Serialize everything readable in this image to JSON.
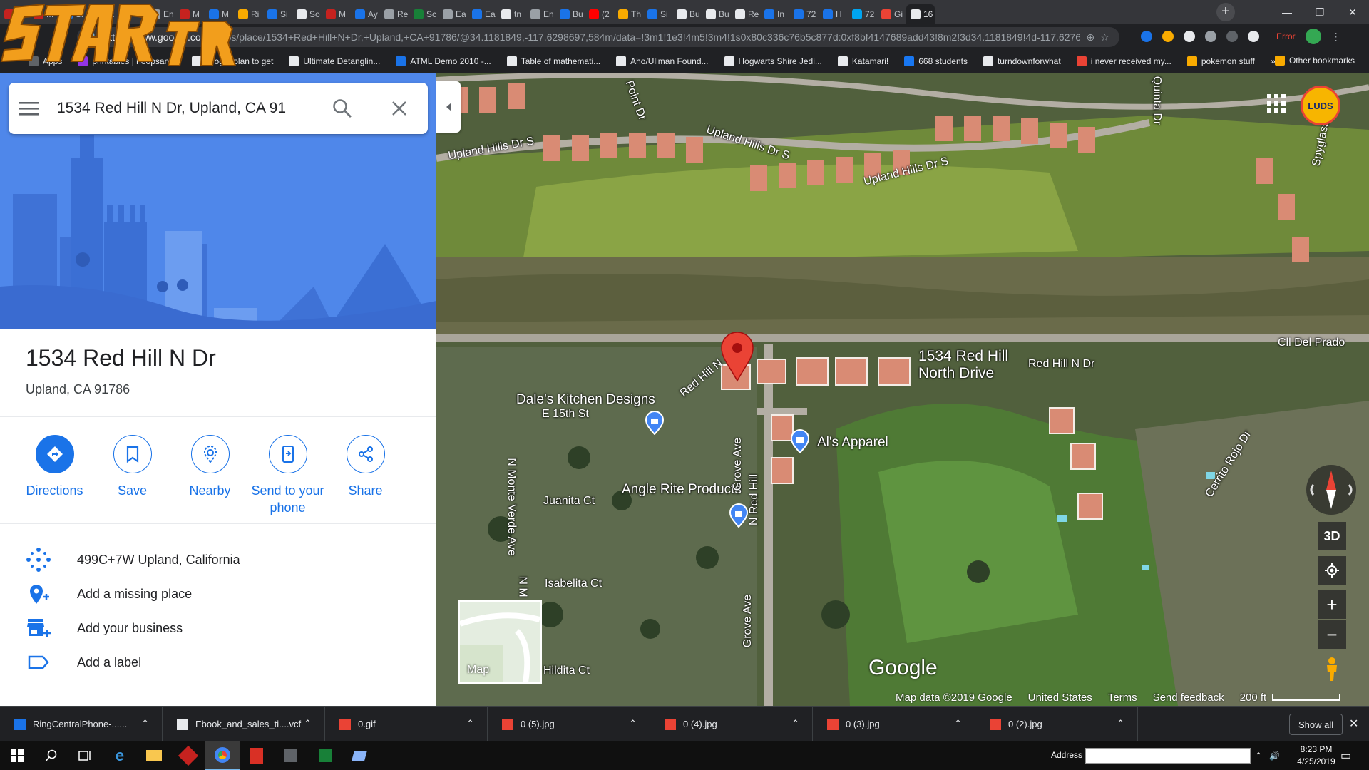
{
  "browser": {
    "tabs": [
      {
        "label": "M",
        "color": "#c5221f"
      },
      {
        "label": "M",
        "color": "#c5221f"
      },
      {
        "label": "Si",
        "color": "#1a73e8"
      },
      {
        "label": "72",
        "color": "#188038"
      },
      {
        "label": "M",
        "color": "#c5221f"
      },
      {
        "label": "En",
        "color": "#9aa0a6"
      },
      {
        "label": "M",
        "color": "#c5221f"
      },
      {
        "label": "M",
        "color": "#1a73e8"
      },
      {
        "label": "Ri",
        "color": "#f9ab00"
      },
      {
        "label": "Si",
        "color": "#1a73e8"
      },
      {
        "label": "So",
        "color": "#e8eaed"
      },
      {
        "label": "M",
        "color": "#c5221f"
      },
      {
        "label": "Ay",
        "color": "#1a73e8"
      },
      {
        "label": "Re",
        "color": "#9aa0a6"
      },
      {
        "label": "Sc",
        "color": "#188038"
      },
      {
        "label": "Ea",
        "color": "#9aa0a6"
      },
      {
        "label": "Ea",
        "color": "#1a73e8"
      },
      {
        "label": "tn",
        "color": "#e8eaed"
      },
      {
        "label": "En",
        "color": "#9aa0a6"
      },
      {
        "label": "Bu",
        "color": "#1a73e8"
      },
      {
        "label": "(2",
        "color": "#ff0000"
      },
      {
        "label": "Th",
        "color": "#f9ab00"
      },
      {
        "label": "Si",
        "color": "#1a73e8"
      },
      {
        "label": "Bu",
        "color": "#e8eaed"
      },
      {
        "label": "Bu",
        "color": "#e8eaed"
      },
      {
        "label": "Re",
        "color": "#e8eaed"
      },
      {
        "label": "In",
        "color": "#1a73e8"
      },
      {
        "label": "72",
        "color": "#1a73e8"
      },
      {
        "label": "H",
        "color": "#1a73e8"
      },
      {
        "label": "72",
        "color": "#00a4ef"
      },
      {
        "label": "Gi",
        "color": "#ea4335"
      },
      {
        "label": "16",
        "color": "#e8eaed"
      }
    ],
    "new_tab_label": "+",
    "window_controls": {
      "minimize": "—",
      "maximize": "❐",
      "close": "✕"
    },
    "url_main": "https://www.google.com",
    "url_rest": "/maps/place/1534+Red+Hill+N+Dr,+Upland,+CA+91786/@34.1181849,-117.6298697,584m/data=!3m1!1e3!4m5!3m4!1s0x80c336c76b5c877d:0xf8bf4147689add43!8m2!3d34.1181849!4d-117.627681",
    "error_label": "Error",
    "bookmarks": [
      {
        "label": "Apps",
        "color": "#5f6368"
      },
      {
        "label": "printables | hoopsan...",
        "color": "#9334e6"
      },
      {
        "label": "Frog: I plan to get",
        "color": "#e8eaed"
      },
      {
        "label": "Ultimate Detanglin...",
        "color": "#e8eaed"
      },
      {
        "label": "ATML Demo 2010 -...",
        "color": "#1a73e8"
      },
      {
        "label": "Table of mathemati...",
        "color": "#e8eaed"
      },
      {
        "label": "Aho/Ullman Found...",
        "color": "#e8eaed"
      },
      {
        "label": "Hogwarts Shire Jedi...",
        "color": "#e8eaed"
      },
      {
        "label": "Katamari!",
        "color": "#e8eaed"
      },
      {
        "label": "668 students",
        "color": "#1877f2"
      },
      {
        "label": "turndownforwhat",
        "color": "#e8eaed"
      },
      {
        "label": "i never received my...",
        "color": "#ea4335"
      },
      {
        "label": "pokemon stuff",
        "color": "#f9ab00"
      }
    ],
    "bookmarks_more": "»",
    "other_bookmarks": "Other bookmarks"
  },
  "maps": {
    "search_value": "1534 Red Hill N Dr, Upland, CA 91",
    "place_title": "1534 Red Hill N Dr",
    "place_address": "Upland, CA 91786",
    "actions": [
      {
        "label": "Directions",
        "icon": "directions-icon"
      },
      {
        "label": "Save",
        "icon": "bookmark-icon"
      },
      {
        "label": "Nearby",
        "icon": "nearby-icon"
      },
      {
        "label": "Send to your phone",
        "icon": "send-to-phone-icon"
      },
      {
        "label": "Share",
        "icon": "share-icon"
      }
    ],
    "info_rows": [
      {
        "text": "499C+7W Upland, California",
        "icon": "plus-code-icon"
      },
      {
        "text": "Add a missing place",
        "icon": "add-place-icon"
      },
      {
        "text": "Add your business",
        "icon": "add-business-icon"
      },
      {
        "text": "Add a label",
        "icon": "label-icon"
      }
    ],
    "map_labels": {
      "pin_label_line1": "1534 Red Hill",
      "pin_label_line2": "North Drive",
      "dales": "Dale's Kitchen Designs",
      "als": "Al's Apparel",
      "angle": "Angle Rite Products",
      "juanita": "Juanita Ct",
      "isabelita": "Isabelita Ct",
      "hildita": "Hildita Ct",
      "e15th": "E 15th St",
      "upland_hills_1": "Upland Hills Dr S",
      "upland_hills_2": "Upland Hills Dr S",
      "upland_hills_3": "Upland Hills Dr S",
      "red_hill_n_dr": "Red Hill N Dr",
      "red_hill_n": "Red Hill N",
      "n_red_hill": "N Red Hill",
      "grove_ave_1": "Grove Ave",
      "grove_ave_2": "Grove Ave",
      "monte_verde": "N Monte Verde Ave",
      "n_m": "N M",
      "point_dr": "Point Dr",
      "quinta_dr": "Quinta Dr",
      "spyglass_dr": "Spyglass Dr",
      "cll_del_prado": "Cll Del Prado",
      "cerrito_rojo": "Cerrito Rojo Dr"
    },
    "minimap_label": "Map",
    "btn_3d": "3D",
    "zoom_in": "+",
    "zoom_out": "−",
    "google_logo": "Google",
    "attribution": [
      "Map data ©2019 Google",
      "United States",
      "Terms",
      "Send feedback"
    ],
    "scale": "200 ft",
    "avatar_text": "LUDS"
  },
  "downloads": {
    "items": [
      {
        "name": "RingCentralPhone-......",
        "color": "#1a73e8"
      },
      {
        "name": "Ebook_and_sales_ti....vcf",
        "color": "#e8eaed"
      },
      {
        "name": "0.gif",
        "color": "#ea4335"
      },
      {
        "name": "0 (5).jpg",
        "color": "#ea4335"
      },
      {
        "name": "0 (4).jpg",
        "color": "#ea4335"
      },
      {
        "name": "0 (3).jpg",
        "color": "#ea4335"
      },
      {
        "name": "0 (2).jpg",
        "color": "#ea4335"
      }
    ],
    "show_all": "Show all",
    "close": "✕"
  },
  "taskbar": {
    "address_label": "Address",
    "time": "8:23 PM",
    "date": "4/25/2019"
  }
}
